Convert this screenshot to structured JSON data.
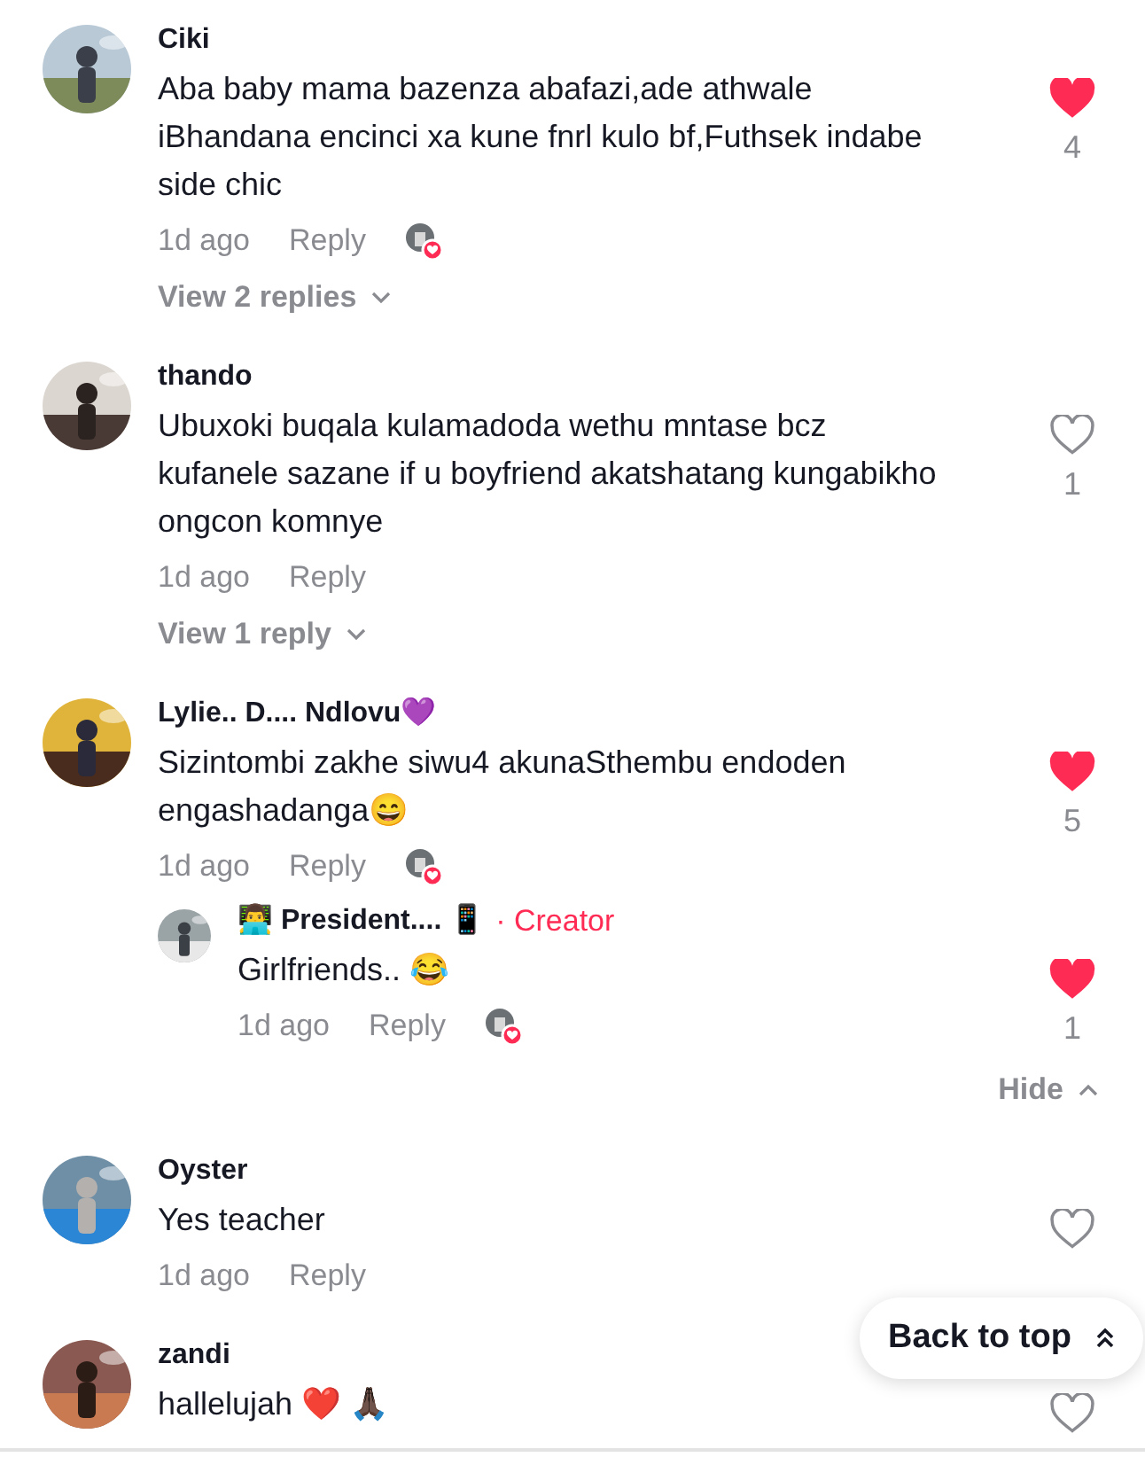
{
  "comments": [
    {
      "author": "Ciki",
      "text": "Aba baby mama bazenza abafazi,ade athwale iBhandana encinci xa kune fnrl kulo bf,Futhsek indabe side chic",
      "time": "1d ago",
      "reply_label": "Reply",
      "creator_liked": true,
      "liked": true,
      "likes": "4",
      "view_replies": "View 2 replies"
    },
    {
      "author": "thando",
      "text": "Ubuxoki buqala kulamadoda wethu mntase bcz kufanele sazane if u boyfriend akatshatang kungabikho ongcon komnye",
      "time": "1d ago",
      "reply_label": "Reply",
      "creator_liked": false,
      "liked": false,
      "likes": "1",
      "view_replies": "View 1 reply"
    },
    {
      "author": "Lylie.. D.... Ndlovu💜",
      "text": "Sizintombi zakhe siwu4 akunaSthembu endoden engashadanga😄",
      "time": "1d ago",
      "reply_label": "Reply",
      "creator_liked": true,
      "liked": true,
      "likes": "5",
      "replies": [
        {
          "author": "👨‍💻 President.... 📱",
          "creator_badge": "· Creator",
          "text": "Girlfriends.. 😂",
          "time": "1d ago",
          "reply_label": "Reply",
          "creator_liked": true,
          "liked": true,
          "likes": "1"
        }
      ],
      "hide_label": "Hide"
    },
    {
      "author": "Oyster",
      "text": "Yes teacher",
      "time": "1d ago",
      "reply_label": "Reply",
      "creator_liked": false,
      "liked": false
    },
    {
      "author": "zandi",
      "text": "hallelujah ❤️ 🙏🏿",
      "liked": false
    }
  ],
  "back_to_top": {
    "label": "Back to top"
  }
}
